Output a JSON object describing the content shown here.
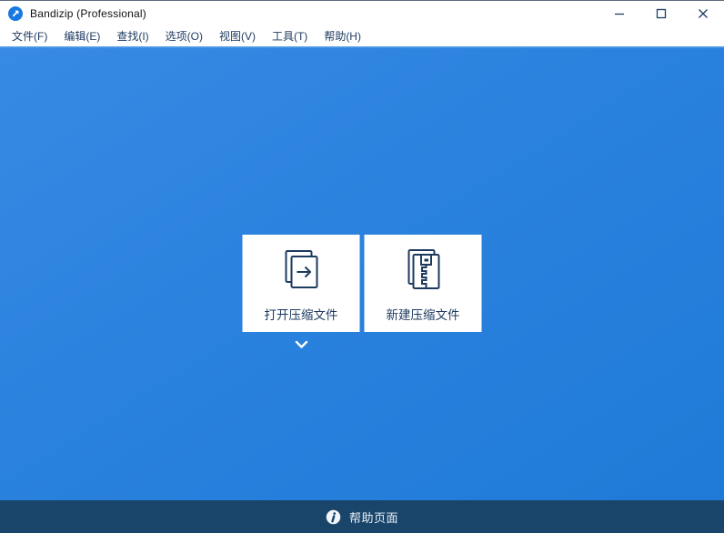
{
  "window": {
    "title": "Bandizip (Professional)",
    "app_logo_icon": "bandizip-logo",
    "controls": [
      {
        "name": "minimize",
        "icon": "minimize-icon"
      },
      {
        "name": "maximize",
        "icon": "maximize-icon"
      },
      {
        "name": "close",
        "icon": "close-icon"
      }
    ]
  },
  "menu": {
    "items": [
      {
        "label": "文件(F)"
      },
      {
        "label": "编辑(E)"
      },
      {
        "label": "查找(I)"
      },
      {
        "label": "选项(O)"
      },
      {
        "label": "视图(V)"
      },
      {
        "label": "工具(T)"
      },
      {
        "label": "帮助(H)"
      }
    ]
  },
  "main": {
    "cards": [
      {
        "label": "打开压缩文件",
        "icon": "open-archive-icon"
      },
      {
        "label": "新建压缩文件",
        "icon": "new-archive-icon"
      }
    ],
    "more_indicator_icon": "chevron-down-icon"
  },
  "statusbar": {
    "label": "帮助页面",
    "icon": "help-info-icon"
  },
  "colors": {
    "background_blue_top": "#378ae3",
    "background_blue_bottom": "#1f7ad7",
    "statusbar_navy": "#1a456b",
    "icon_navy": "#1d3a5f",
    "logo_blue": "#1778e0",
    "chrome_white": "#ffffff"
  }
}
